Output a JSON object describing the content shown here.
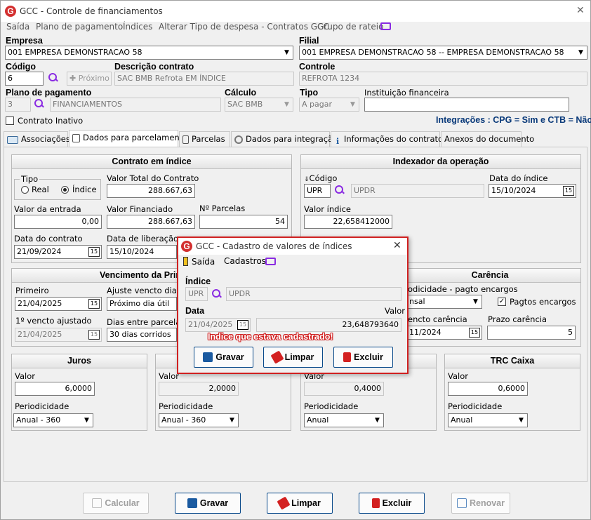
{
  "window": {
    "title": "GCC - Controle de financiamentos",
    "close": "✕"
  },
  "menu": [
    "Saída",
    "Plano de pagamento",
    "Índices",
    "Alterar Tipo de despesa - Contratos GCC",
    "Grupo de rateio"
  ],
  "empresa": {
    "label": "Empresa",
    "value": "001 EMPRESA DEMONSTRACAO 58"
  },
  "filial": {
    "label": "Filial",
    "value": "001 EMPRESA DEMONSTRACAO 58 -- EMPRESA DEMONSTRACAO 58"
  },
  "codigo": {
    "label": "Código",
    "value": "6",
    "proximo": "Próximo"
  },
  "descricao": {
    "label": "Descrição contrato",
    "value": "SAC BMB Refrota EM ÍNDICE"
  },
  "controle": {
    "label": "Controle",
    "value": "REFROTA 1234"
  },
  "plano": {
    "label": "Plano de pagamento",
    "code": "3",
    "name": "FINANCIAMENTOS"
  },
  "calculo": {
    "label": "Cálculo",
    "value": "SAC BMB"
  },
  "tipo": {
    "label": "Tipo",
    "value": "A pagar"
  },
  "instituicao": {
    "label": "Instituição financeira",
    "value": ""
  },
  "contrato_inativo": "Contrato Inativo",
  "integracoes": "Integrações : CPG = Sim e CTB = Não",
  "tabs": [
    "Associações",
    "Dados para parcelamento",
    "Parcelas",
    "Dados para integração",
    "Informações do contrato",
    "Anexos do documento"
  ],
  "contrato_indice": {
    "title": "Contrato em índice",
    "tipo_label": "Tipo",
    "real": "Real",
    "indice": "Índice",
    "valor_total_label": "Valor Total do Contrato",
    "valor_total": "288.667,63",
    "valor_entrada_label": "Valor da entrada",
    "valor_entrada": "0,00",
    "valor_financiado_label": "Valor Financiado",
    "valor_financiado": "288.667,63",
    "parcelas_label": "Nº Parcelas",
    "parcelas": "54",
    "data_contrato_label": "Data do contrato",
    "data_contrato": "21/09/2024",
    "data_liberacao_label": "Data de liberação",
    "data_liberacao": "15/10/2024"
  },
  "indexador": {
    "title": "Indexador da operação",
    "codigo_label": "Código",
    "codigo": "UPR",
    "codigo_desc": "UPDR",
    "data_indice_label": "Data do índice",
    "data_indice": "15/10/2024",
    "valor_indice_label": "Valor índice",
    "valor_indice": "22,658412000"
  },
  "vencimento": {
    "title": "Vencimento da Prim",
    "primeiro_label": "Primeiro",
    "primeiro": "21/04/2025",
    "ajuste_label": "Ajuste vencto dia não",
    "ajuste": "Próximo dia útil",
    "ajustado_label": "1º vencto ajustado",
    "ajustado": "21/04/2025",
    "dias_label": "Dias entre parcelas",
    "dias": "30 dias corridos"
  },
  "carencia": {
    "title": "Carência",
    "period_label": "odicidade - pagto encargos",
    "period": "nsal",
    "pagos": "Pagtos encargos",
    "vencto_label": "encto carência",
    "vencto": "11/2024",
    "prazo_label": "Prazo carência",
    "prazo": "5"
  },
  "juros": {
    "title": "Juros",
    "valor_label": "Valor",
    "valor": "6,0000",
    "period_label": "Periodicidade",
    "period": "Anual - 360"
  },
  "g2": {
    "valor_label": "Valor",
    "valor": "2,0000",
    "period_label": "Periodicidade",
    "period": "Anual - 360"
  },
  "g3": {
    "valor_label": "Valor",
    "valor": "0,4000",
    "period_label": "Periodicidade",
    "period": "Anual"
  },
  "trc": {
    "title": "TRC Caixa",
    "valor_label": "Valor",
    "valor": "0,6000",
    "period_label": "Periodicidade",
    "period": "Anual"
  },
  "bottom": {
    "calcular": "Calcular",
    "gravar": "Gravar",
    "limpar": "Limpar",
    "excluir": "Excluir",
    "renovar": "Renovar"
  },
  "dialog": {
    "title": "GCC - Cadastro de valores de índices",
    "close": "✕",
    "menu_saida": "Saída",
    "menu_cadastros": "Cadastros",
    "indice_label": "Índice",
    "indice_code": "UPR",
    "indice_desc": "UPDR",
    "data_label": "Data",
    "data": "21/04/2025",
    "valor_label": "Valor",
    "valor": "23,648793640",
    "alert": "Indice que estava cadastrado!",
    "gravar": "Gravar",
    "limpar": "Limpar",
    "excluir": "Excluir"
  },
  "colors": {
    "accent": "#0a4a8a",
    "alert": "#d02020",
    "logo": "#d32f2f",
    "icon": "#8a2be2"
  }
}
